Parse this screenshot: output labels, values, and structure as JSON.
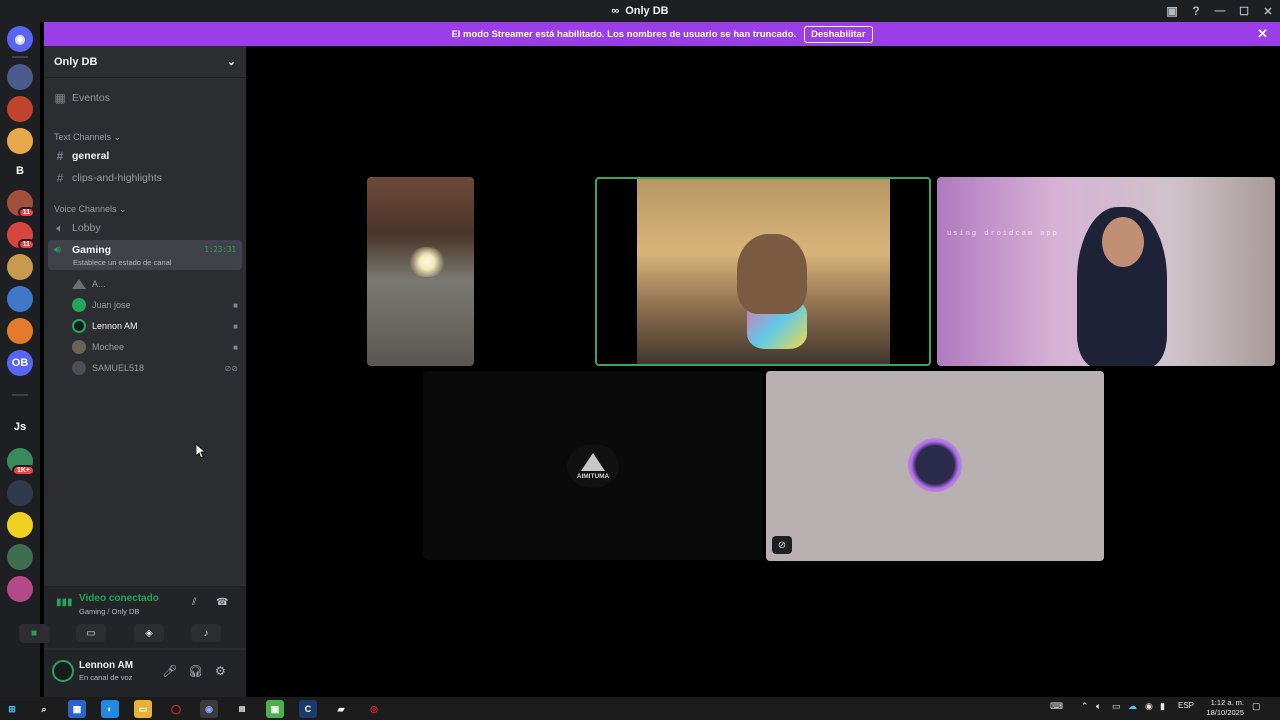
{
  "window": {
    "title": "Only DB"
  },
  "banner": {
    "message": "El modo Streamer está habilitado. Los nombres de usuario se han truncado.",
    "disable_label": "Deshabilitar"
  },
  "rail": {
    "letter_server": "B",
    "ob_server": "OB",
    "js_server": "Js",
    "badges": [
      "11",
      "11",
      "1K+"
    ]
  },
  "server": {
    "name": "Only DB"
  },
  "sidebar": {
    "events_label": "Eventos",
    "text_category": "Text Channels",
    "text_channels": [
      "general",
      "clips-and-highlights"
    ],
    "voice_category": "Voice Channels",
    "voice_channels": [
      "Lobby",
      "Gaming"
    ],
    "active_voice": {
      "name": "Gaming",
      "status": "Establece un estado de canal",
      "timer": "1:23:31"
    },
    "voice_users": [
      "A...",
      "Juan jose",
      "Lennon AM",
      "Mochee",
      "SAMUEL518"
    ]
  },
  "voice_panel": {
    "title": "Video conectado",
    "subtitle": "Gaming / Only DB"
  },
  "user_panel": {
    "name": "Lennon AM",
    "status": "En canal de voz"
  },
  "stage": {
    "watermark": "using droidcam app",
    "logo_text": "AIMITUMA"
  },
  "taskbar": {
    "lang": "ESP",
    "time": "1:12 a. m.",
    "date": "18/10/2025"
  },
  "colors": {
    "banner": "#9b3ee8",
    "online": "#23a55a",
    "speaking_border": "#3ba55c"
  }
}
